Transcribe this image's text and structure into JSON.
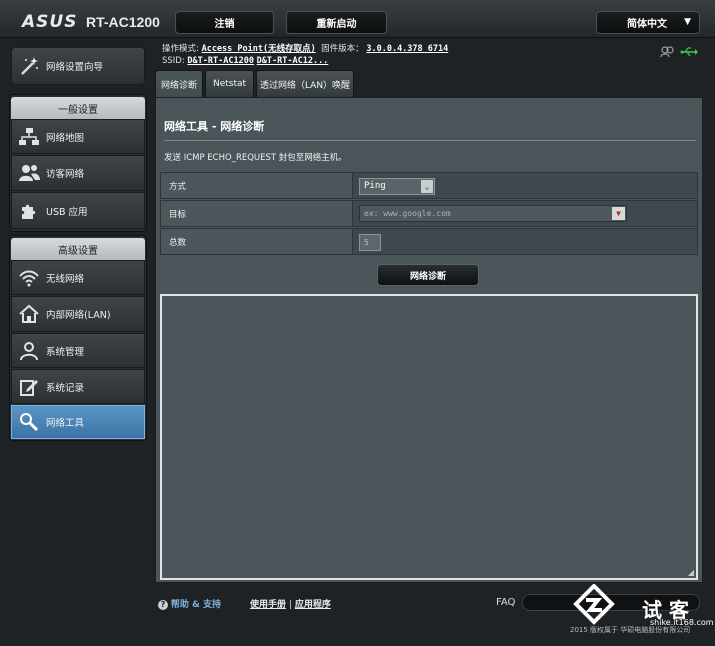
{
  "header": {
    "brand": "ASUS",
    "model": "RT-AC1200",
    "logout": "注销",
    "reboot": "重新启动",
    "language": "简体中文"
  },
  "sidebar": {
    "wizard": "网络设置向导",
    "general_title": "一般设置",
    "general_items": [
      {
        "label": "网络地图",
        "icon": "network-map-icon"
      },
      {
        "label": "访客网络",
        "icon": "guest-network-icon"
      },
      {
        "label": "USB 应用",
        "icon": "usb-app-icon"
      }
    ],
    "advanced_title": "高级设置",
    "advanced_items": [
      {
        "label": "无线网络",
        "icon": "wireless-icon"
      },
      {
        "label": "内部网络(LAN)",
        "icon": "lan-icon"
      },
      {
        "label": "系统管理",
        "icon": "admin-icon"
      },
      {
        "label": "系统记录",
        "icon": "syslog-icon"
      },
      {
        "label": "网络工具",
        "icon": "network-tools-icon",
        "active": true
      }
    ]
  },
  "status": {
    "mode_label": "操作模式:",
    "mode_value": "Access Point(无线存取点)",
    "fw_label": "固件版本：",
    "fw_value": "3.0.0.4.378_6714",
    "ssid_label": "SSID:",
    "ssid1": "D&T-RT-AC1200",
    "ssid2": "D&T-RT-AC12..."
  },
  "tabs": [
    "网络诊断",
    "Netstat",
    "透过网络（LAN）唤醒"
  ],
  "main": {
    "title": "网络工具 - 网络诊断",
    "description": "发送 ICMP ECHO_REQUEST 封包至网络主机。",
    "method_label": "方式",
    "method_value": "Ping",
    "target_label": "目标",
    "target_placeholder": "ex: www.google.com",
    "count_label": "总数",
    "count_value": "5",
    "diagnose_button": "网络诊断"
  },
  "footer": {
    "help": "帮助 & 支持",
    "manual": "使用手册",
    "separator": "|",
    "utility": "应用程序",
    "faq": "FAQ",
    "copyright": "2015 版权属于 华硕电脑股份有限公司"
  },
  "watermark": {
    "text": "试 客",
    "url": "shike.it168.com"
  },
  "colors": {
    "active_tab": "#4a7fb0",
    "panel_bg": "#4b5559",
    "background": "#1f2224"
  }
}
